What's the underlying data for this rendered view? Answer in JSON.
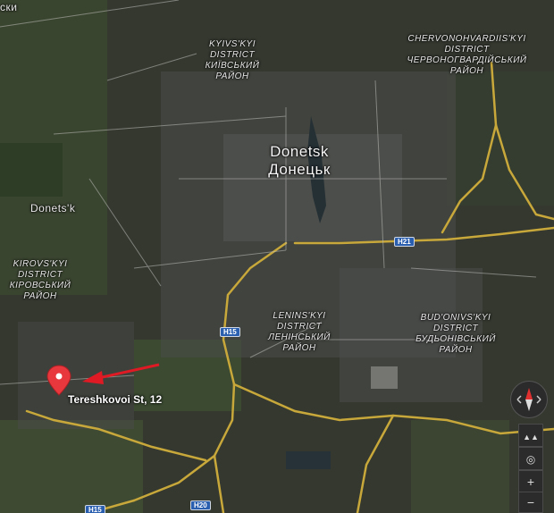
{
  "map": {
    "city_en": "Donetsk",
    "city_uk": "Донецьк",
    "district_kyivskyi": [
      "KYIVS'KYI",
      "DISTRICT",
      "КИЇВСЬКИЙ",
      "РАЙОН"
    ],
    "district_chervonohvardiiskyi": [
      "CHERVONOHVARDIIS'KYI",
      "DISTRICT",
      "ЧЕРВОНОГВАРДІЙСЬКИЙ",
      "РАЙОН"
    ],
    "district_kirovskyi": [
      "KIROVS'KYI",
      "DISTRICT",
      "КІРОВСЬКИЙ",
      "РАЙОН"
    ],
    "district_leninskyi": [
      "LENINS'KYI",
      "DISTRICT",
      "ЛЕНІНСЬКИЙ",
      "РАЙОН"
    ],
    "district_budonivskyi": [
      "BUD'ONIVS'KYI",
      "DISTRICT",
      "БУДЬОНІВСЬКИЙ",
      "РАЙОН"
    ],
    "top_fragment": "ски",
    "settlement": "Donets'k",
    "routes": [
      "H21",
      "H15",
      "H15",
      "H20"
    ],
    "pin_label": "Tereshkovoi St, 12"
  },
  "controls": {
    "zoom_in": "+",
    "zoom_out": "−"
  },
  "colors": {
    "road": "#c8a83a",
    "pin": "#e8383d",
    "arrow": "#e01a24"
  }
}
